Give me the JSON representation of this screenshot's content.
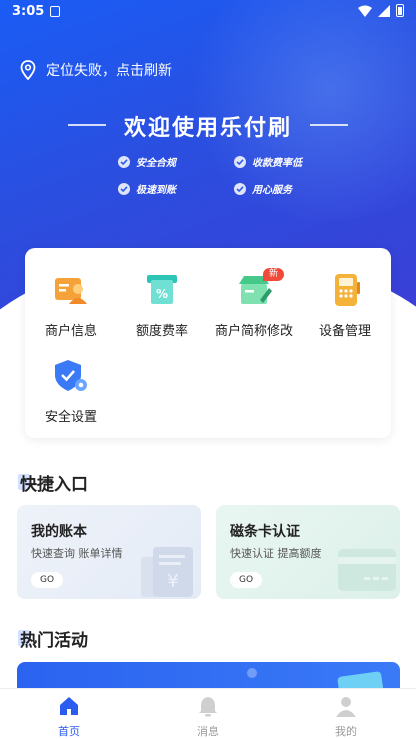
{
  "status_bar": {
    "time": "3:05"
  },
  "location": {
    "text": "定位失败，点击刷新"
  },
  "welcome": {
    "title": "欢迎使用乐付刷",
    "features": [
      "安全合规",
      "收款费率低",
      "极速到账",
      "用心服务"
    ]
  },
  "menu": {
    "items": [
      {
        "label": "商户信息",
        "icon": "merchant-info-icon"
      },
      {
        "label": "额度费率",
        "icon": "rate-icon"
      },
      {
        "label": "商户简称修改",
        "icon": "shop-edit-icon",
        "badge": "新"
      },
      {
        "label": "设备管理",
        "icon": "pos-device-icon"
      },
      {
        "label": "安全设置",
        "icon": "shield-gear-icon"
      }
    ]
  },
  "quick_entry": {
    "title": "快捷入口",
    "cards": [
      {
        "title": "我的账本",
        "subtitle": "快速查询 账单详情",
        "go": "GO"
      },
      {
        "title": "磁条卡认证",
        "subtitle": "快速认证 提高额度",
        "go": "GO"
      }
    ]
  },
  "hot_activity": {
    "title": "热门活动"
  },
  "tabbar": {
    "tabs": [
      {
        "label": "首页",
        "active": true
      },
      {
        "label": "消息",
        "active": false
      },
      {
        "label": "我的",
        "active": false
      }
    ]
  },
  "colors": {
    "primary": "#2a5cf0",
    "hero_top": "#1a5cf5",
    "orange": "#f5a23a",
    "teal": "#2ec4b6"
  }
}
